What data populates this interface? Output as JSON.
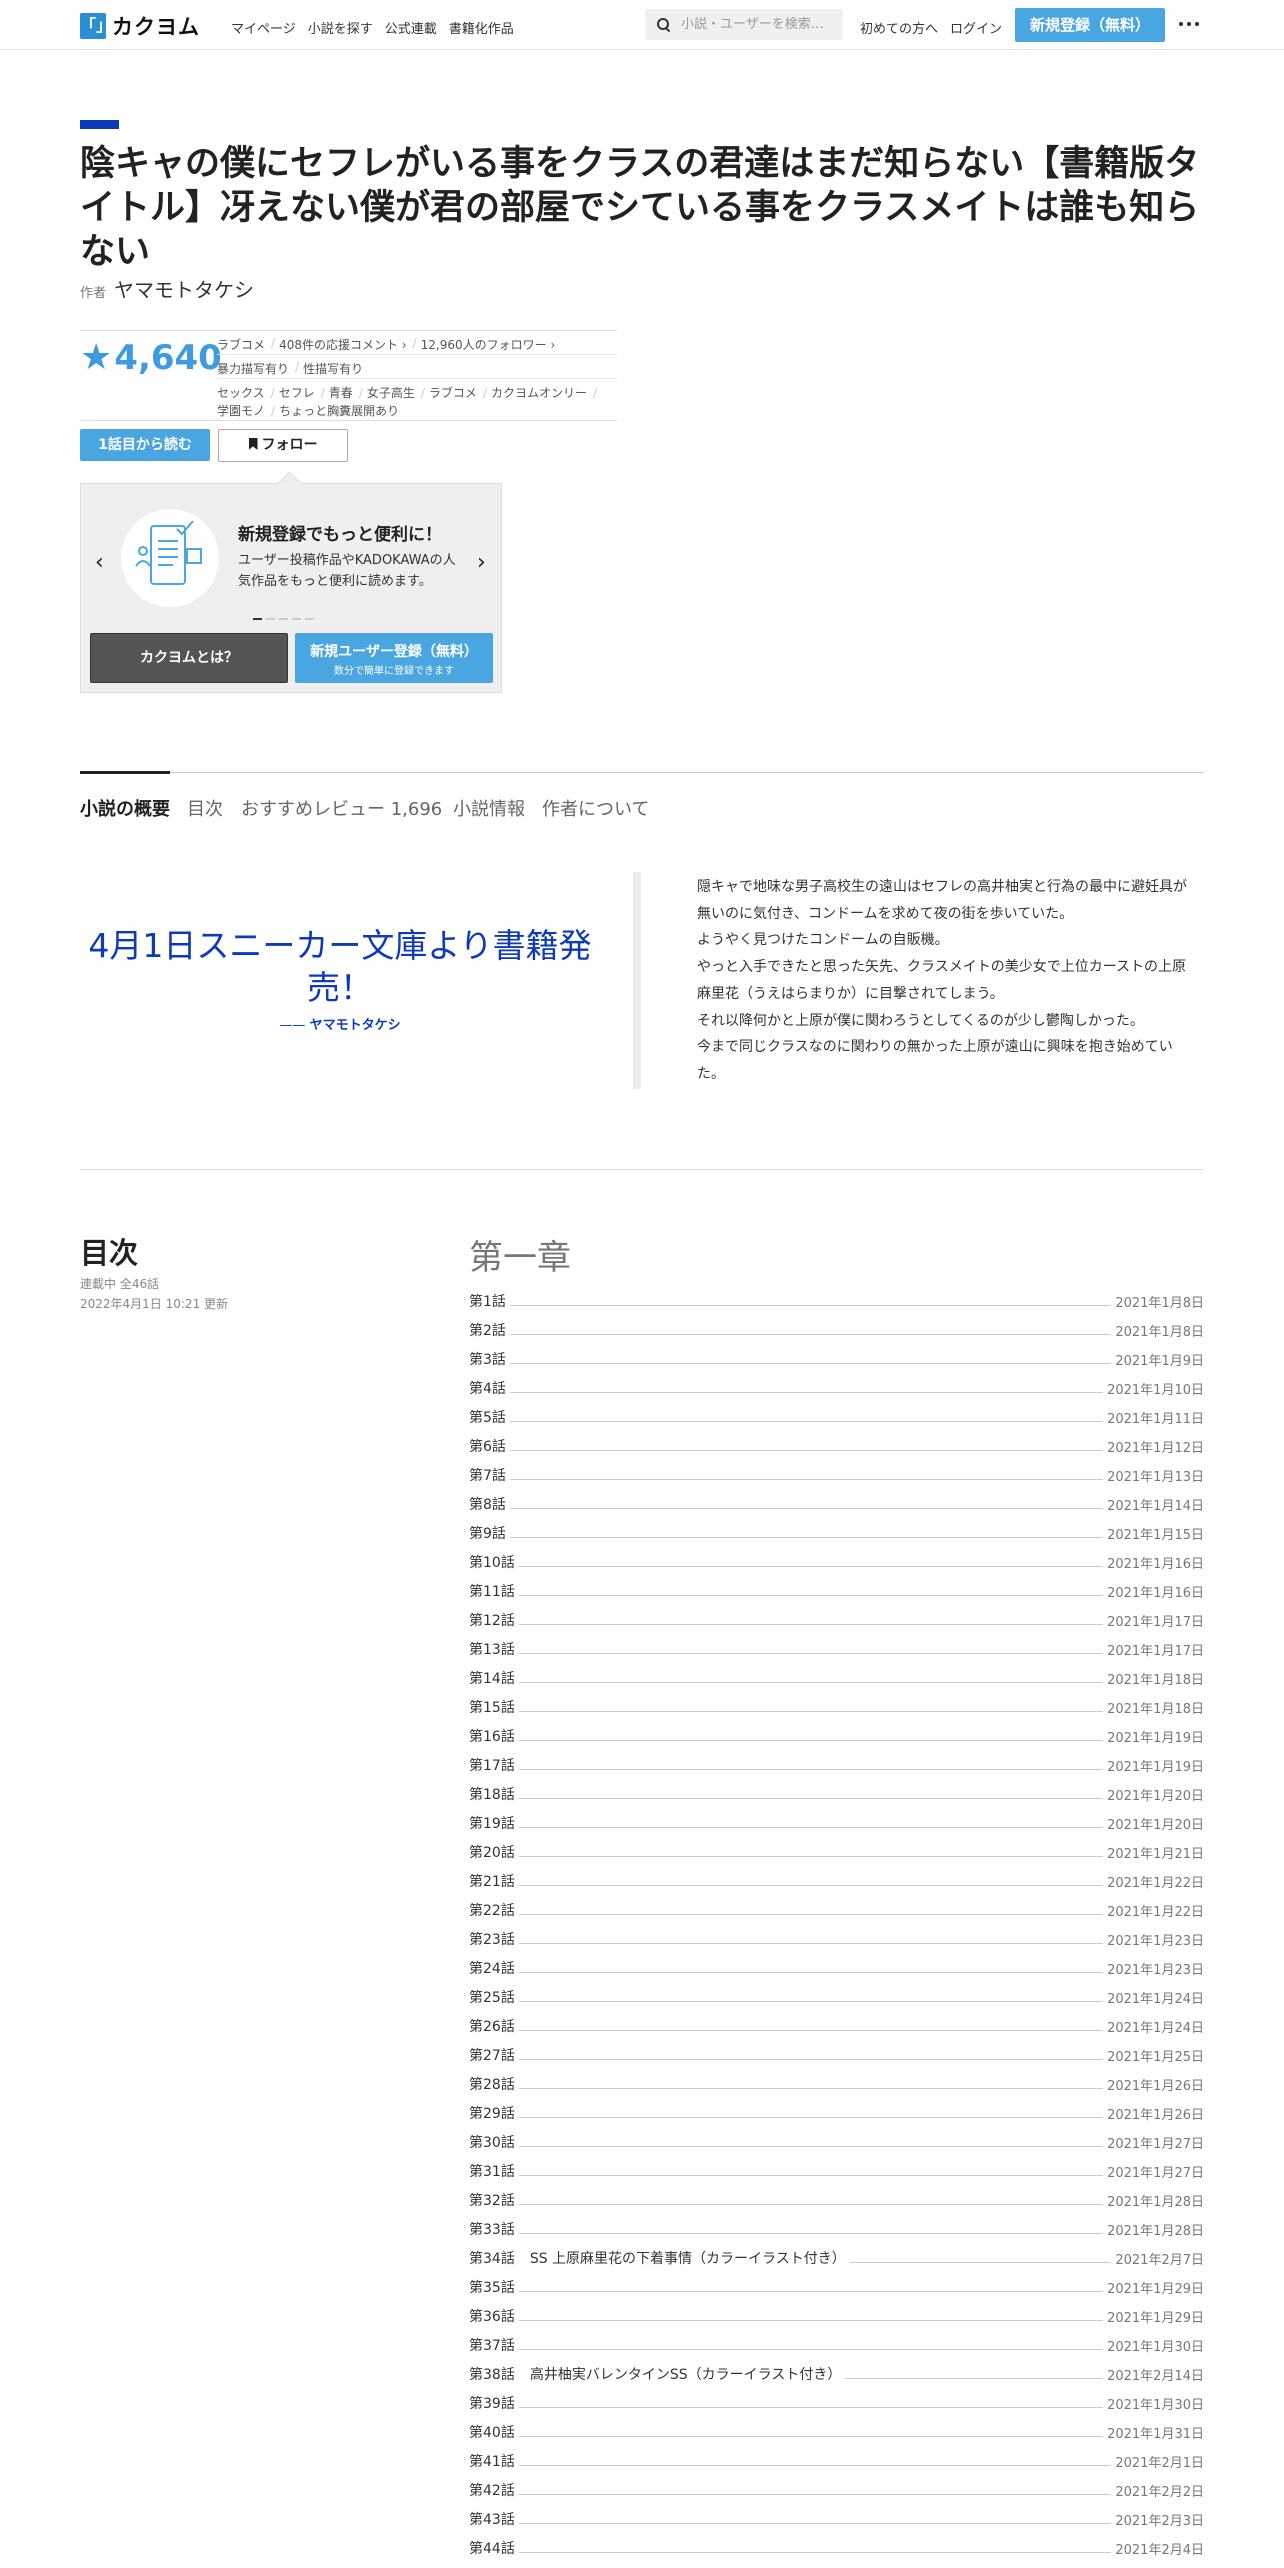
{
  "header": {
    "logo_mark": "「」",
    "logo_text": "カクヨム",
    "nav": [
      "マイページ",
      "小説を探す",
      "公式連載",
      "書籍化作品"
    ],
    "search_placeholder": "小説・ユーザーを検索…",
    "first_time": "初めての方へ",
    "login": "ログイン",
    "register": "新規登録（無料）"
  },
  "work": {
    "title": "陰キャの僕にセフレがいる事をクラスの君達はまだ知らない【書籍版タイトル】冴えない僕が君の部屋でシている事をクラスメイトは誰も知らない",
    "author_label": "作者",
    "author": "ヤマモトタケシ",
    "stars": "4,640",
    "genre": "ラブコメ",
    "comments": "408件の応援コメント",
    "followers": "12,960人のフォロワー",
    "warnings": [
      "暴力描写有り",
      "性描写有り"
    ],
    "tags": [
      "セックス",
      "セフレ",
      "青春",
      "女子高生",
      "ラブコメ",
      "カクヨムオンリー",
      "学園モノ",
      "ちょっと胸糞展開あり"
    ],
    "read_button": "1話目から読む",
    "follow_button": "フォロー"
  },
  "promo": {
    "title": "新規登録でもっと便利に！",
    "text": "ユーザー投稿作品やKADOKAWAの人気作品をもっと便利に読めます。",
    "about_button": "カクヨムとは？",
    "register_button": "新規ユーザー登録（無料）",
    "register_sub": "数分で簡単に登録できます",
    "colors": {
      "accent": "#4aa6e0",
      "dark": "#555555"
    }
  },
  "tabs": [
    "小説の概要",
    "目次",
    "おすすめレビュー 1,696",
    "小説情報",
    "作者について"
  ],
  "overview": {
    "catchphrase": "4月1日スニーカー文庫より書籍発売！",
    "catch_author": "ヤマモトタケシ",
    "intro": [
      "隠キャで地味な男子高校生の遠山はセフレの高井柚実と行為の最中に避妊具が無いのに気付き、コンドームを求めて夜の街を歩いていた。",
      "ようやく見つけたコンドームの自販機。",
      "やっと入手できたと思った矢先、クラスメイトの美少女で上位カーストの上原麻里花（うえはらまりか）に目撃されてしまう。",
      "それ以降何かと上原が僕に関わろうとしてくるのが少し鬱陶しかった。",
      "今まで同じクラスなのに関わりの無かった上原が遠山に興味を抱き始めていた。"
    ]
  },
  "toc": {
    "title": "目次",
    "status": "連載中 全46話",
    "updated": "2022年4月1日 10:21 更新",
    "chapter": "第一章",
    "episodes": [
      {
        "num": "第1話",
        "sub": "",
        "date": "2021年1月8日"
      },
      {
        "num": "第2話",
        "sub": "",
        "date": "2021年1月8日"
      },
      {
        "num": "第3話",
        "sub": "",
        "date": "2021年1月9日"
      },
      {
        "num": "第4話",
        "sub": "",
        "date": "2021年1月10日"
      },
      {
        "num": "第5話",
        "sub": "",
        "date": "2021年1月11日"
      },
      {
        "num": "第6話",
        "sub": "",
        "date": "2021年1月12日"
      },
      {
        "num": "第7話",
        "sub": "",
        "date": "2021年1月13日"
      },
      {
        "num": "第8話",
        "sub": "",
        "date": "2021年1月14日"
      },
      {
        "num": "第9話",
        "sub": "",
        "date": "2021年1月15日"
      },
      {
        "num": "第10話",
        "sub": "",
        "date": "2021年1月16日"
      },
      {
        "num": "第11話",
        "sub": "",
        "date": "2021年1月16日"
      },
      {
        "num": "第12話",
        "sub": "",
        "date": "2021年1月17日"
      },
      {
        "num": "第13話",
        "sub": "",
        "date": "2021年1月17日"
      },
      {
        "num": "第14話",
        "sub": "",
        "date": "2021年1月18日"
      },
      {
        "num": "第15話",
        "sub": "",
        "date": "2021年1月18日"
      },
      {
        "num": "第16話",
        "sub": "",
        "date": "2021年1月19日"
      },
      {
        "num": "第17話",
        "sub": "",
        "date": "2021年1月19日"
      },
      {
        "num": "第18話",
        "sub": "",
        "date": "2021年1月20日"
      },
      {
        "num": "第19話",
        "sub": "",
        "date": "2021年1月20日"
      },
      {
        "num": "第20話",
        "sub": "",
        "date": "2021年1月21日"
      },
      {
        "num": "第21話",
        "sub": "",
        "date": "2021年1月22日"
      },
      {
        "num": "第22話",
        "sub": "",
        "date": "2021年1月22日"
      },
      {
        "num": "第23話",
        "sub": "",
        "date": "2021年1月23日"
      },
      {
        "num": "第24話",
        "sub": "",
        "date": "2021年1月23日"
      },
      {
        "num": "第25話",
        "sub": "",
        "date": "2021年1月24日"
      },
      {
        "num": "第26話",
        "sub": "",
        "date": "2021年1月24日"
      },
      {
        "num": "第27話",
        "sub": "",
        "date": "2021年1月25日"
      },
      {
        "num": "第28話",
        "sub": "",
        "date": "2021年1月26日"
      },
      {
        "num": "第29話",
        "sub": "",
        "date": "2021年1月26日"
      },
      {
        "num": "第30話",
        "sub": "",
        "date": "2021年1月27日"
      },
      {
        "num": "第31話",
        "sub": "",
        "date": "2021年1月27日"
      },
      {
        "num": "第32話",
        "sub": "",
        "date": "2021年1月28日"
      },
      {
        "num": "第33話",
        "sub": "",
        "date": "2021年1月28日"
      },
      {
        "num": "第34話",
        "sub": "SS 上原麻里花の下着事情（カラーイラスト付き）",
        "date": "2021年2月7日"
      },
      {
        "num": "第35話",
        "sub": "",
        "date": "2021年1月29日"
      },
      {
        "num": "第36話",
        "sub": "",
        "date": "2021年1月29日"
      },
      {
        "num": "第37話",
        "sub": "",
        "date": "2021年1月30日"
      },
      {
        "num": "第38話",
        "sub": "高井柚実バレンタインSS（カラーイラスト付き）",
        "date": "2021年2月14日"
      },
      {
        "num": "第39話",
        "sub": "",
        "date": "2021年1月30日"
      },
      {
        "num": "第40話",
        "sub": "",
        "date": "2021年1月31日"
      },
      {
        "num": "第41話",
        "sub": "",
        "date": "2021年2月1日"
      },
      {
        "num": "第42話",
        "sub": "",
        "date": "2021年2月2日"
      },
      {
        "num": "第43話",
        "sub": "",
        "date": "2021年2月3日"
      },
      {
        "num": "第44話",
        "sub": "",
        "date": "2021年2月4日"
      }
    ]
  }
}
